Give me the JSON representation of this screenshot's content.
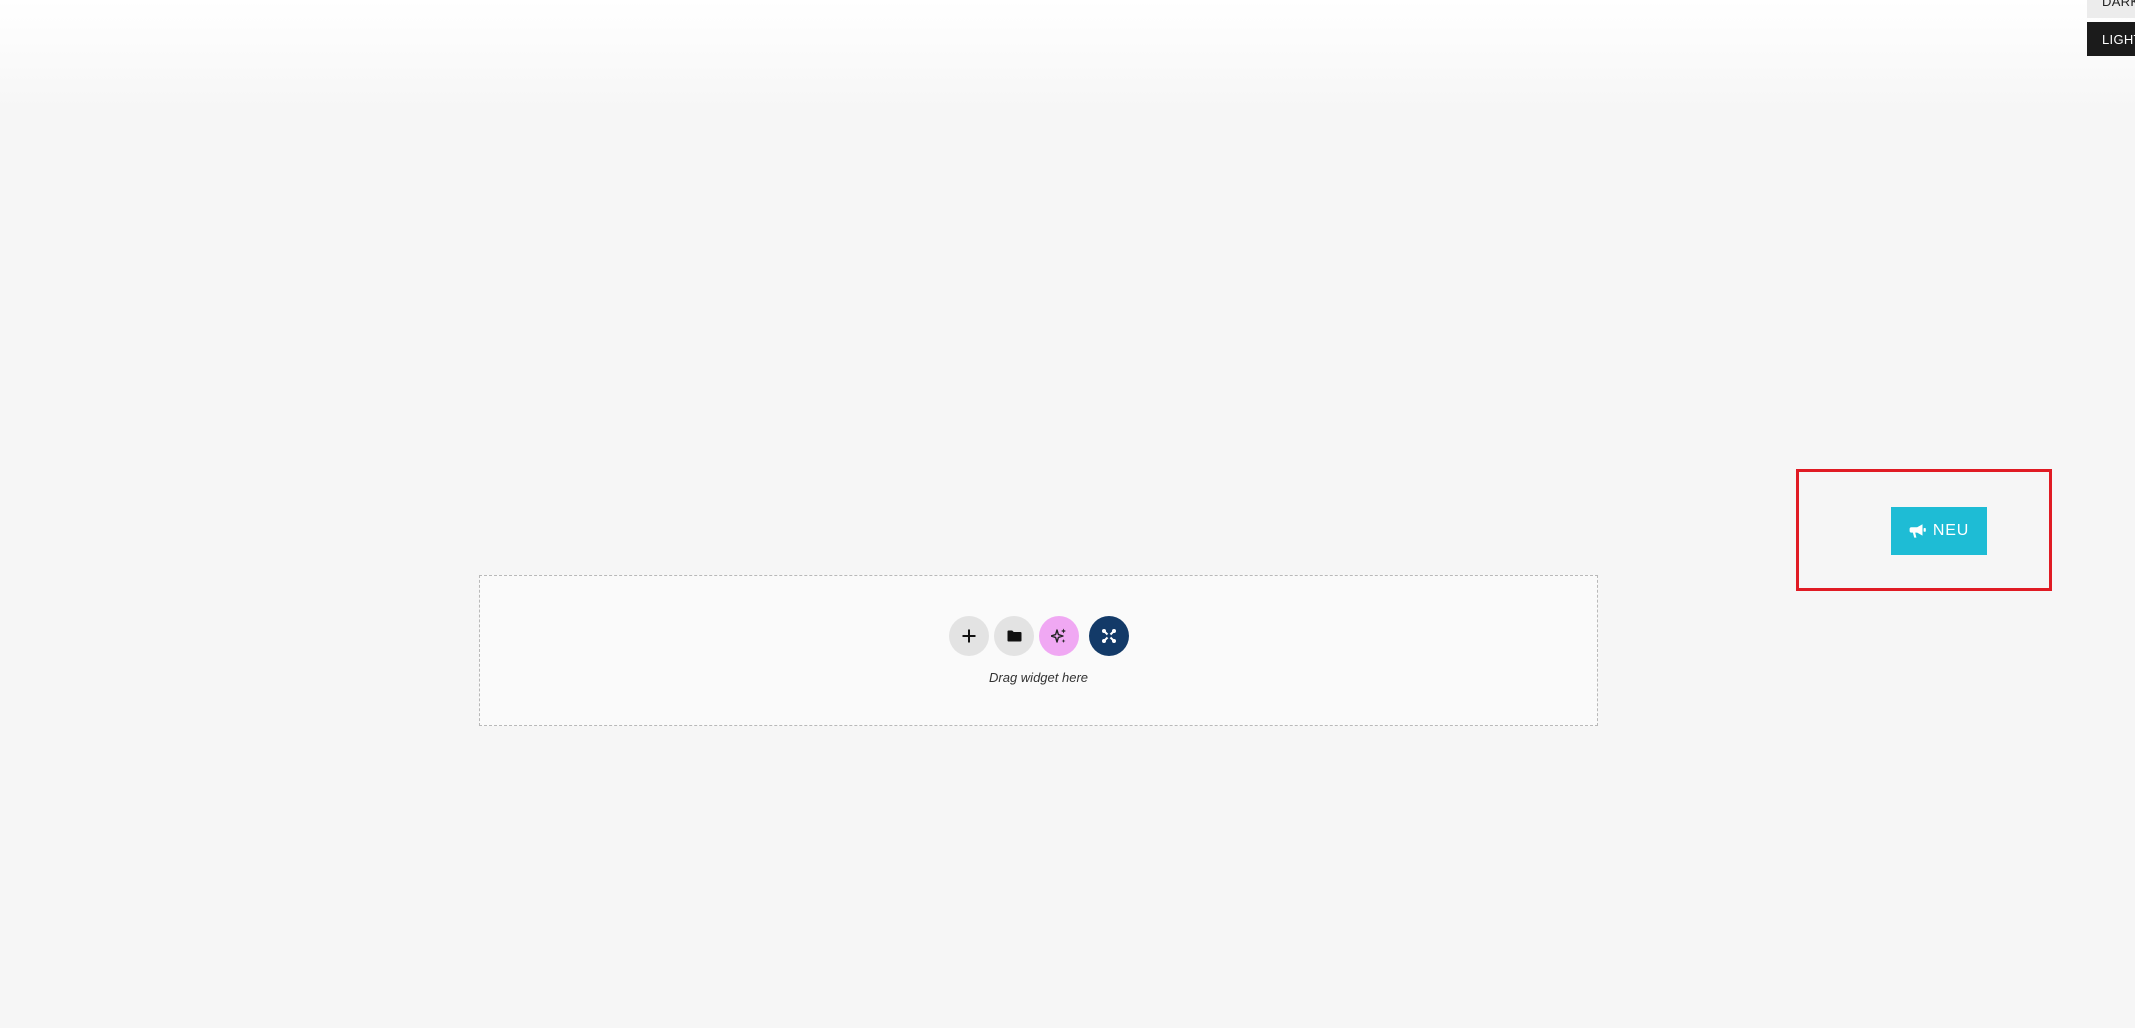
{
  "theme_switch": {
    "dark_label": "DARK",
    "light_label": "LIGHT"
  },
  "announcement": {
    "button_label": "NEU",
    "icon": "megaphone-icon",
    "color": "#1ebcd5",
    "highlight_color": "#e01b24"
  },
  "drop_zone": {
    "hint": "Drag widget here",
    "tools": [
      {
        "name": "add-section-button",
        "icon": "plus-icon",
        "color": "#e3e3e3"
      },
      {
        "name": "templates-button",
        "icon": "folder-icon",
        "color": "#e3e3e3"
      },
      {
        "name": "ai-button",
        "icon": "sparkles-icon",
        "color": "#f0a8f3"
      },
      {
        "name": "plugin-button",
        "icon": "plugin-logo-icon",
        "color": "#133a68"
      }
    ]
  }
}
